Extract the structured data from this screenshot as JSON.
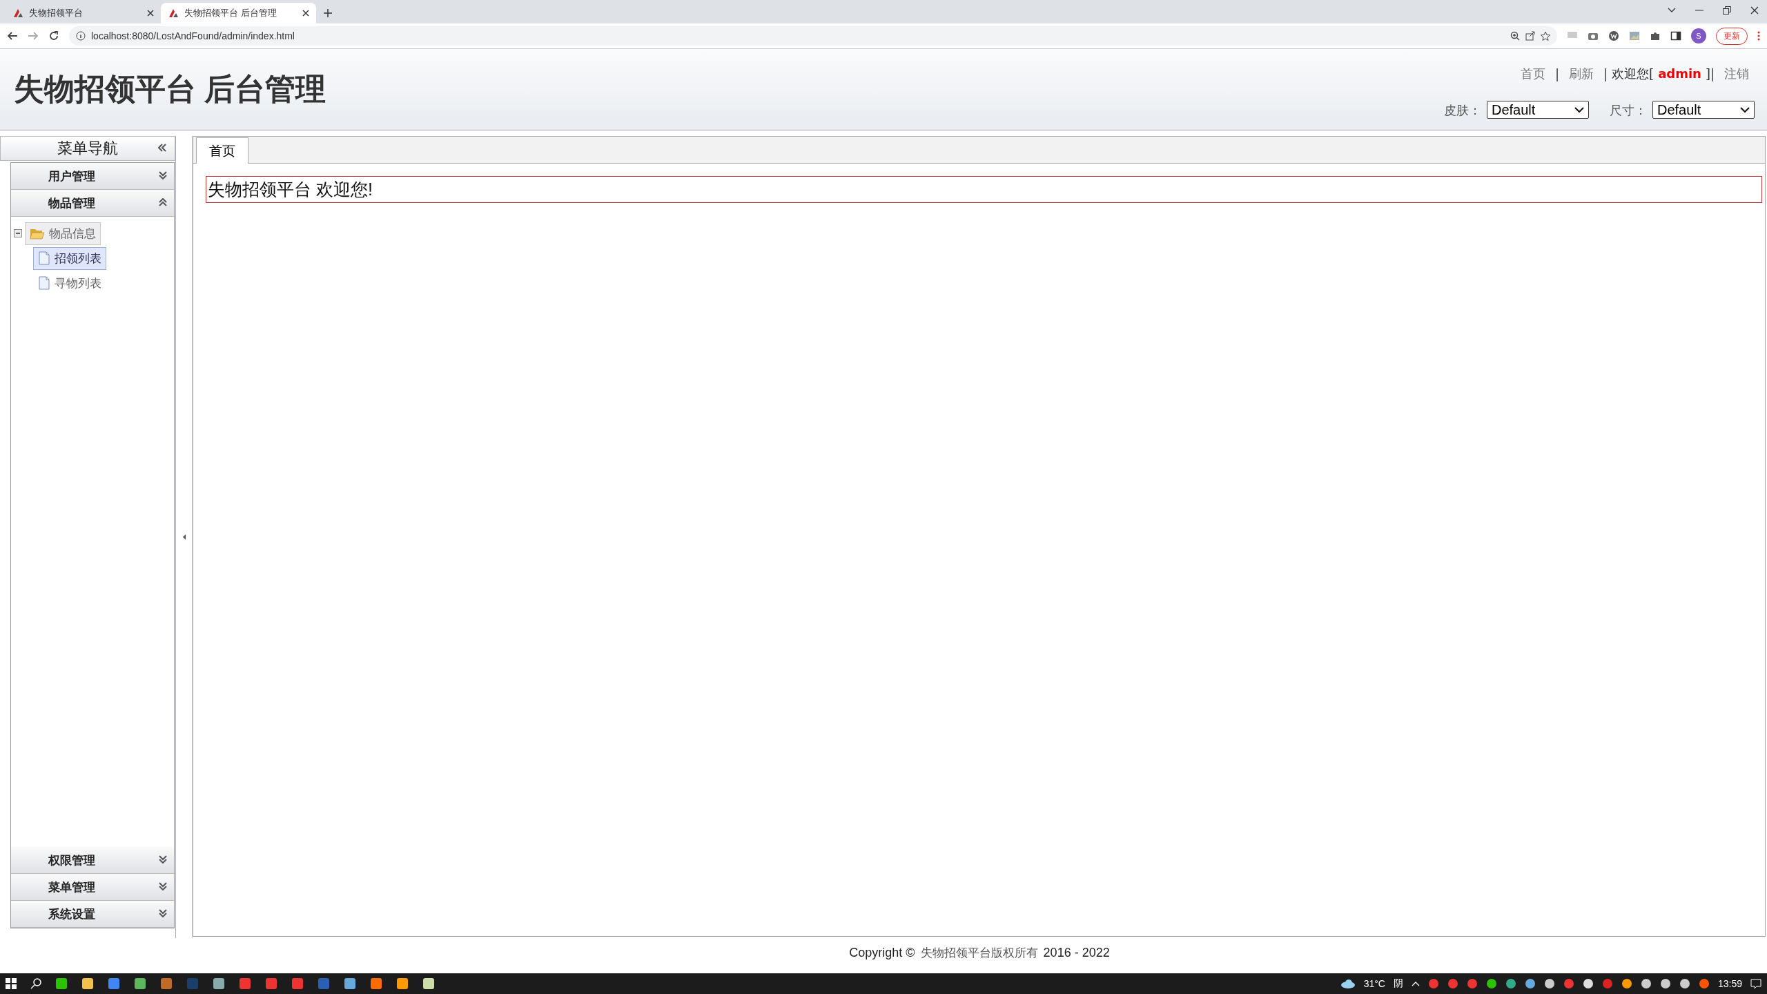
{
  "browser": {
    "tabs": [
      {
        "title": "失物招领平台",
        "selected": false
      },
      {
        "title": "失物招领平台 后台管理",
        "selected": true
      }
    ],
    "address": "localhost:8080/LostAndFound/admin/index.html",
    "profile": "S",
    "update_button": "更新"
  },
  "header": {
    "title": "失物招领平台 后台管理",
    "links": [
      {
        "kind": "link",
        "text": "首页"
      },
      {
        "kind": "sep",
        "text": "|"
      },
      {
        "kind": "link",
        "text": "刷新"
      },
      {
        "kind": "sep",
        "text": "|"
      },
      {
        "kind": "text",
        "text": "欢迎您["
      },
      {
        "kind": "user",
        "text": "admin"
      },
      {
        "kind": "text",
        "text": "]|"
      },
      {
        "kind": "link",
        "text": "注销"
      }
    ],
    "selects": [
      {
        "label": "皮肤：",
        "value": "Default"
      },
      {
        "label": "尺寸：",
        "value": "Default"
      }
    ]
  },
  "sidebar": {
    "title": "菜单导航",
    "sections": [
      {
        "title": "用户管理",
        "expanded": false
      },
      {
        "title": "物品管理",
        "expanded": true,
        "tree": [
          {
            "label": "物品信息",
            "hovered": true,
            "expanded": true,
            "children": [
              {
                "label": "招领列表",
                "selected": true
              },
              {
                "label": "寻物列表",
                "selected": false
              }
            ]
          }
        ]
      },
      {
        "title": "权限管理",
        "expanded": false
      },
      {
        "title": "菜单管理",
        "expanded": false
      },
      {
        "title": "系统设置",
        "expanded": false
      }
    ]
  },
  "main": {
    "tabs": [
      {
        "label": "首页",
        "selected": true
      }
    ],
    "welcome": "失物招领平台 欢迎您!"
  },
  "footer": {
    "prefix": "Copyright ©",
    "owner": "失物招领平台版权所有",
    "years": "2016 - 2022"
  },
  "taskbar": {
    "temperature": "31°C",
    "weather": "阴",
    "clock": "13:59"
  }
}
